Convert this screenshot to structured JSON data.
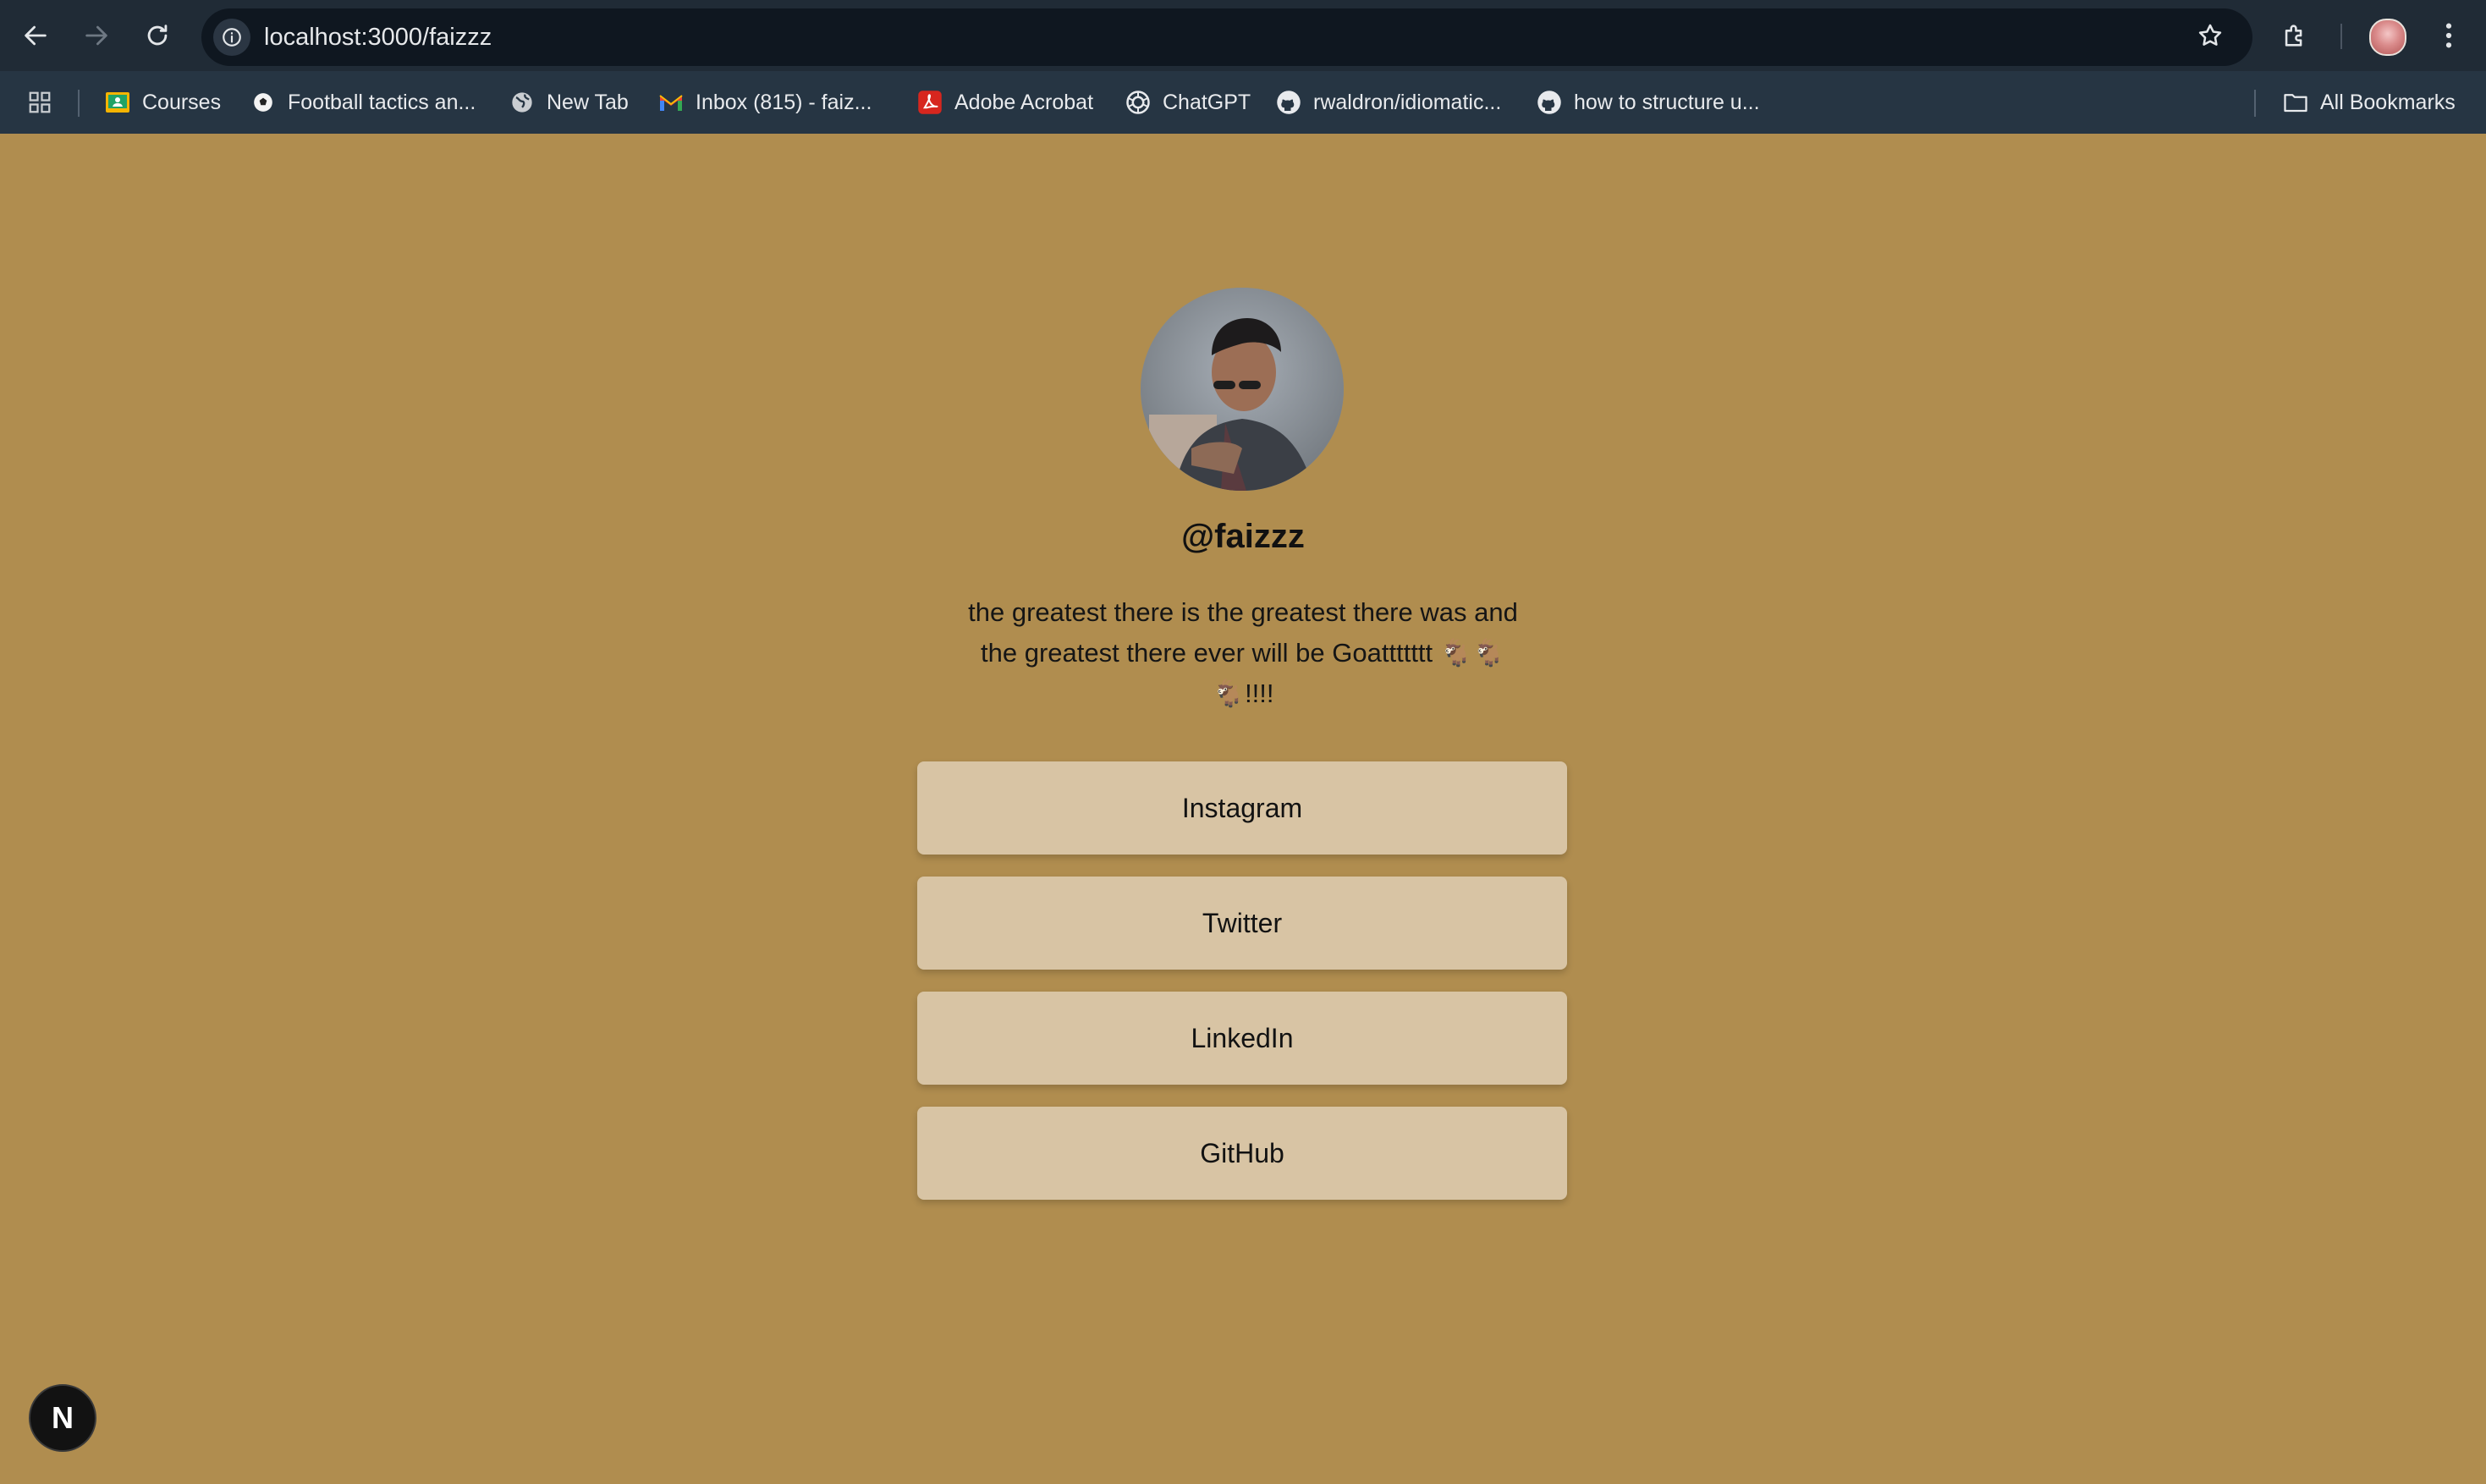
{
  "browser": {
    "url": "localhost:3000/faizzz",
    "bookmarks": [
      {
        "label": "Courses",
        "icon": "classroom-icon"
      },
      {
        "label": "Football tactics an...",
        "icon": "soccer-ball-icon"
      },
      {
        "label": "New Tab",
        "icon": "globe-icon"
      },
      {
        "label": "Inbox (815) - faiz...",
        "icon": "gmail-icon"
      },
      {
        "label": "Adobe Acrobat",
        "icon": "acrobat-icon"
      },
      {
        "label": "ChatGPT",
        "icon": "chatgpt-icon"
      },
      {
        "label": "rwaldron/idiomatic...",
        "icon": "github-icon"
      },
      {
        "label": "how to structure u...",
        "icon": "github-icon"
      }
    ],
    "all_bookmarks_label": "All Bookmarks"
  },
  "profile": {
    "handle": "@faizzz",
    "bio": "the greatest there is the greatest there was and the greatest there ever will be Goattttttt 🐐🐐🐐!!!!"
  },
  "links": [
    {
      "label": "Instagram"
    },
    {
      "label": "Twitter"
    },
    {
      "label": "LinkedIn"
    },
    {
      "label": "GitHub"
    }
  ],
  "dev_badge": {
    "label": "N"
  },
  "colors": {
    "page_background": "#b08d4f",
    "button_background": "#d8c4a4",
    "chrome_topbar": "#202b36",
    "chrome_bookmarks": "#263543"
  }
}
